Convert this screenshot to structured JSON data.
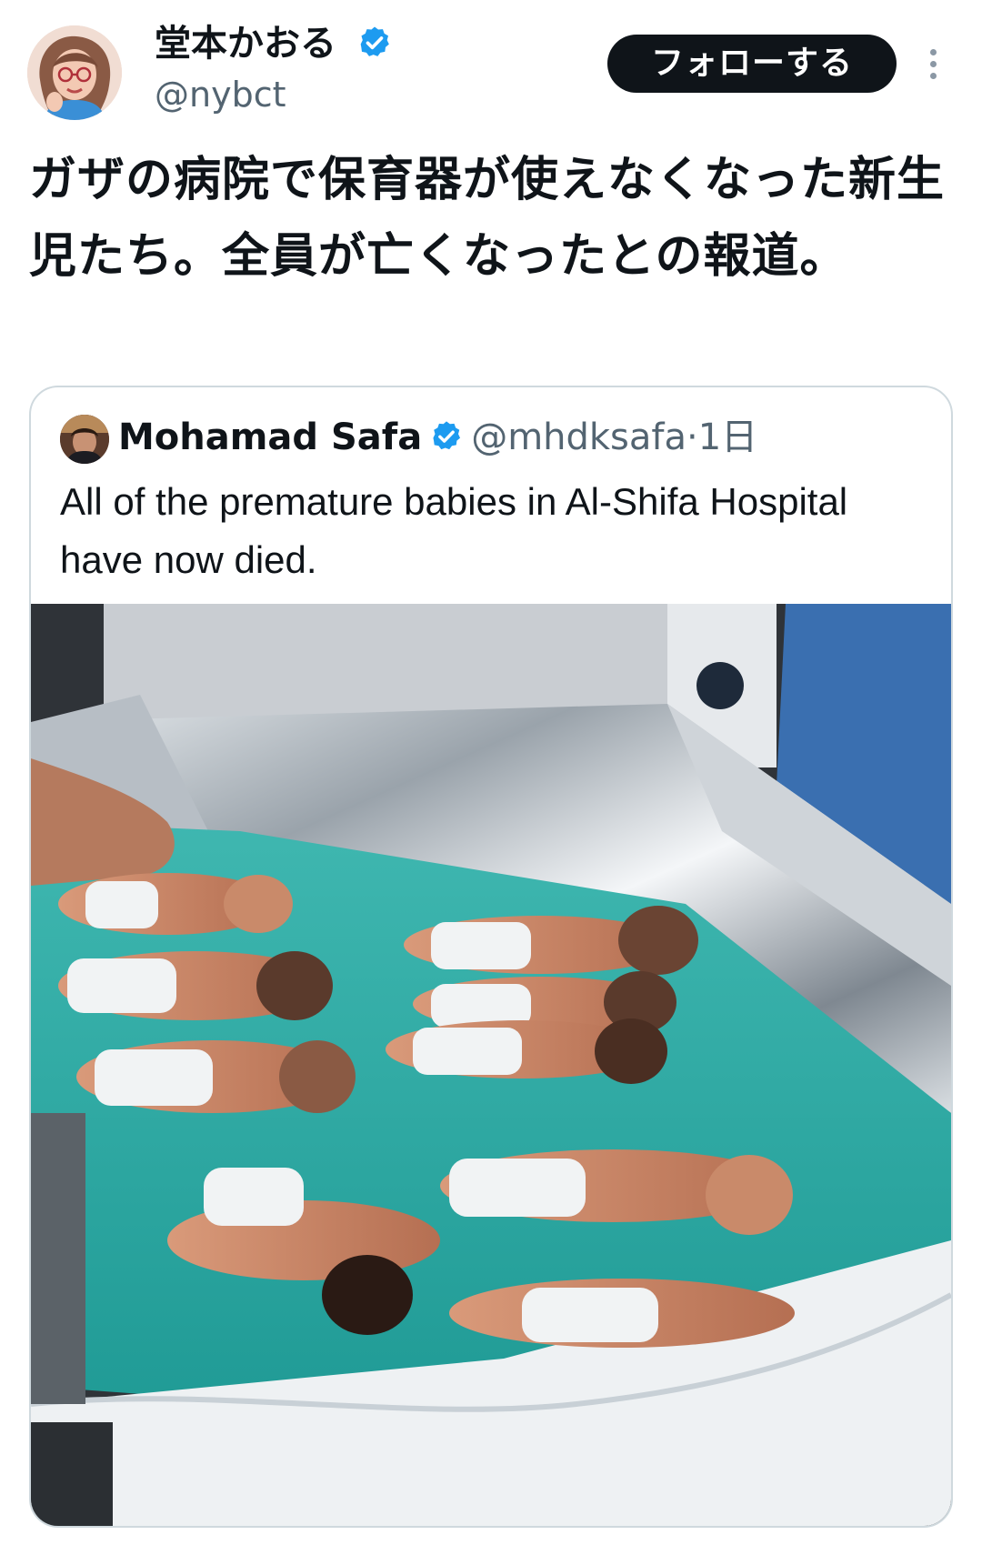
{
  "author": {
    "display_name": "堂本かおる",
    "handle": "@nybct",
    "verified": true,
    "avatar_icon": "avatar-illustration-icon"
  },
  "actions": {
    "follow_label": "フォローする",
    "more_icon": "more-options-icon"
  },
  "tweet": {
    "text": "ガザの病院で保育器が使えなくなった新生児たち。全員が亡くなったとの報道。"
  },
  "quoted": {
    "display_name": "Mohamad Safa",
    "handle": "@mhdksafa",
    "separator": "·",
    "time": "1日",
    "verified": true,
    "text": "All of the premature babies in Al-Shifa Hospital have now died.",
    "media_icon": "photo-media-icon"
  },
  "colors": {
    "verified_blue": "#1d9bf0",
    "text_primary": "#0f1419",
    "text_secondary": "#536471",
    "follow_bg": "#0f1419",
    "card_border": "#cfd9de"
  }
}
